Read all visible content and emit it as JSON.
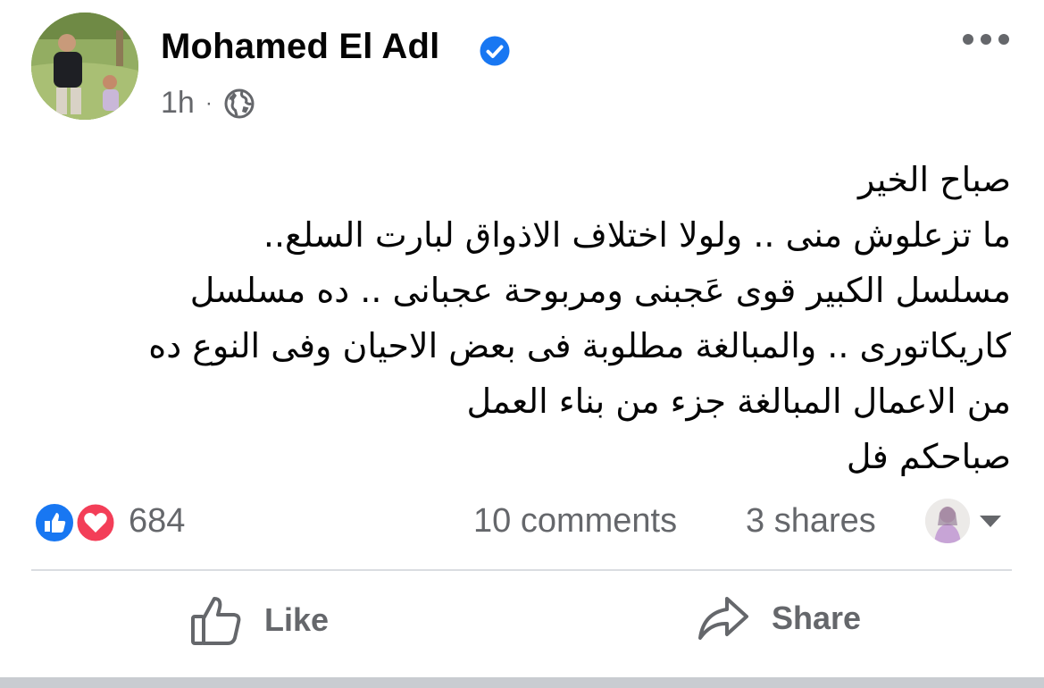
{
  "post": {
    "author": "Mohamed El Adl",
    "time": "1h",
    "separator": "·",
    "lines": [
      "صباح الخير",
      "ما تزعلوش  منى .. ولولا اختلاف الاذواق لبارت السلع..",
      "مسلسل  الكبير قوى عَجبنى ومربوحة عجبانى .. ده مسلسل",
      "كاريكاتورى  .. والمبالغة مطلوبة فى بعض الاحيان وفى النوع ده",
      "من الاعمال المبالغة جزء من بناء العمل",
      "صباحكم فل"
    ]
  },
  "stats": {
    "reactions_count": "684",
    "comments": "10 comments",
    "shares": "3 shares"
  },
  "actions": {
    "like_label": "Like",
    "share_label": "Share"
  },
  "colors": {
    "brand_blue": "#1877f2",
    "love_red": "#f33e58",
    "secondary_text": "#65676b"
  },
  "icons": {
    "verified": "verified-badge-icon",
    "audience": "globe-icon",
    "menu": "more-options-icon",
    "reactions": [
      "like-reaction-icon",
      "love-reaction-icon"
    ],
    "like": "thumbs-up-icon",
    "share": "share-arrow-icon",
    "expand": "caret-down-icon"
  }
}
